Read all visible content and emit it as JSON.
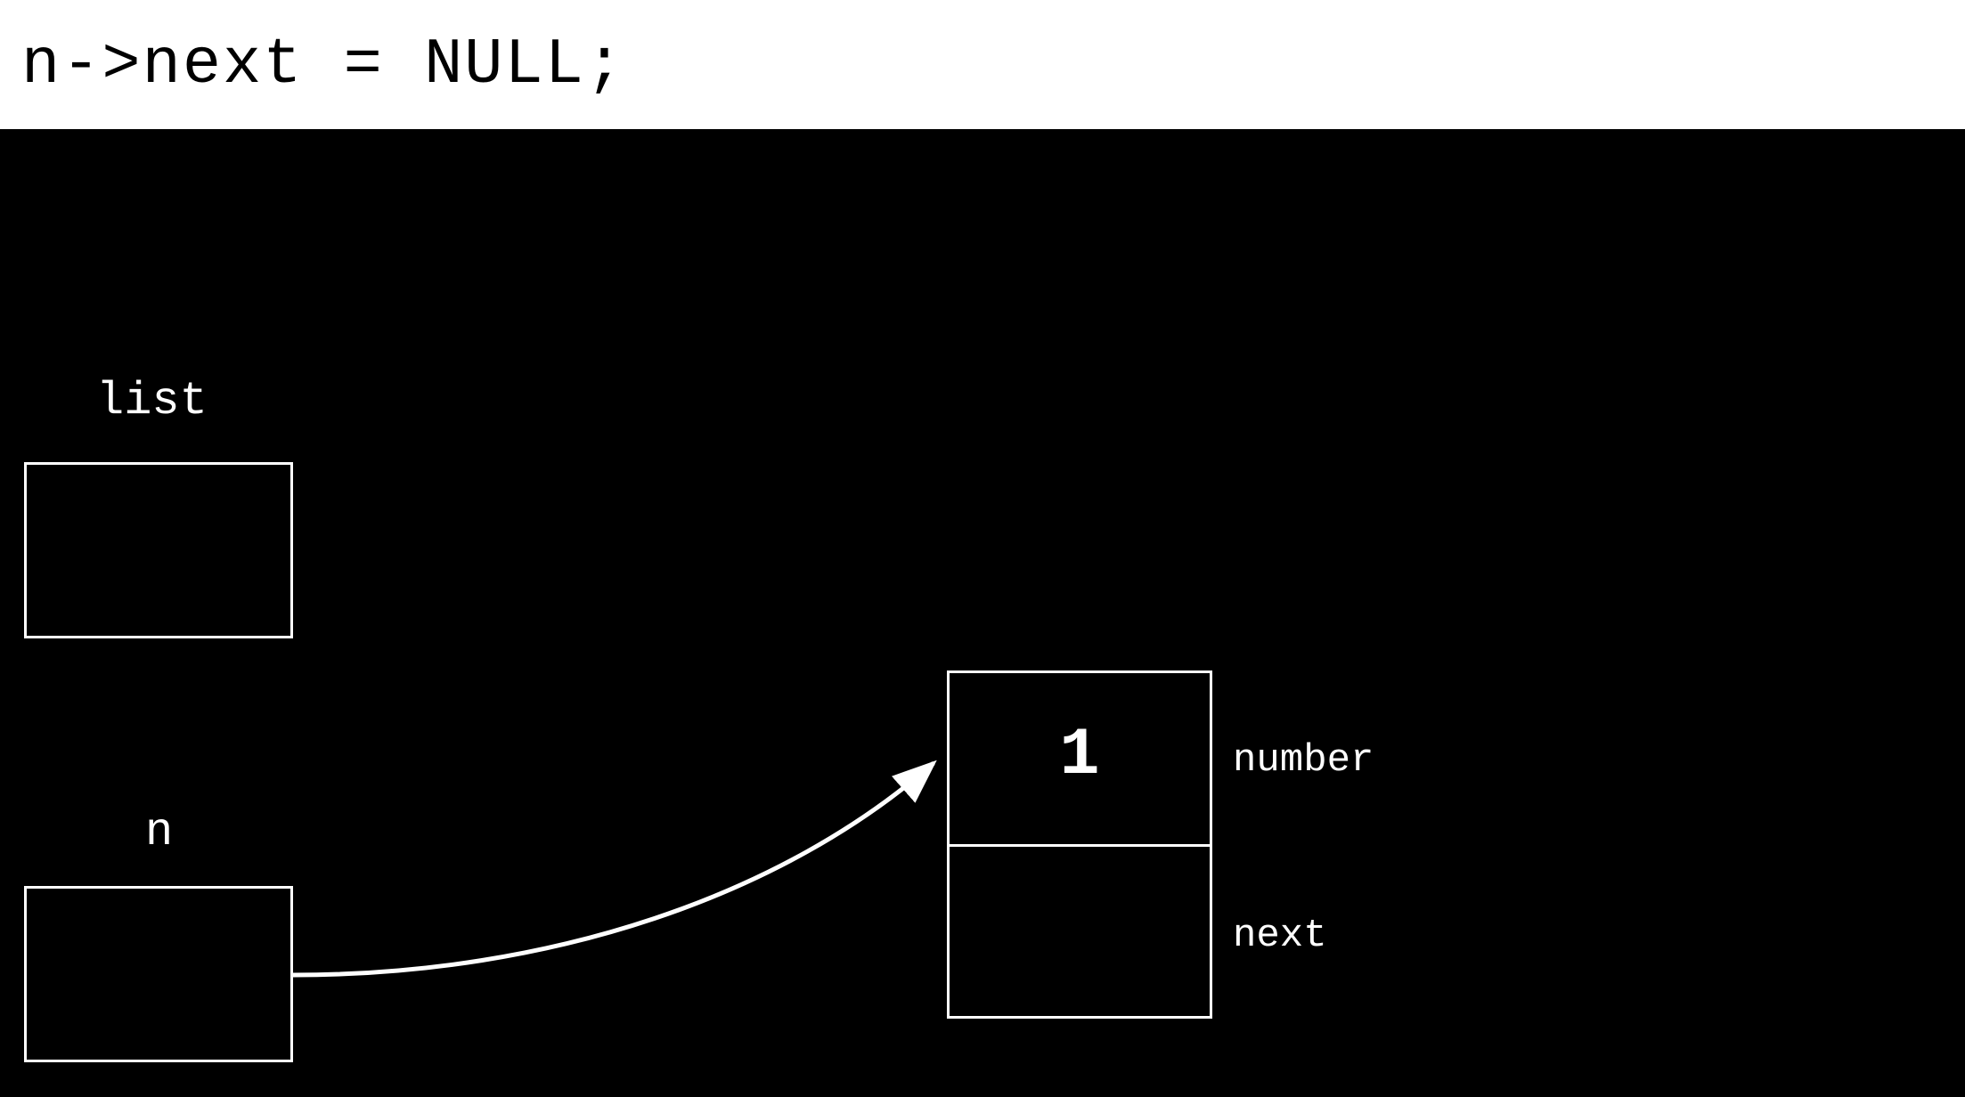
{
  "code_line": "n->next = NULL;",
  "variables": {
    "list": {
      "label": "list"
    },
    "n": {
      "label": "n"
    }
  },
  "node": {
    "number_value": "1",
    "number_field_label": "number",
    "next_field_label": "next"
  }
}
